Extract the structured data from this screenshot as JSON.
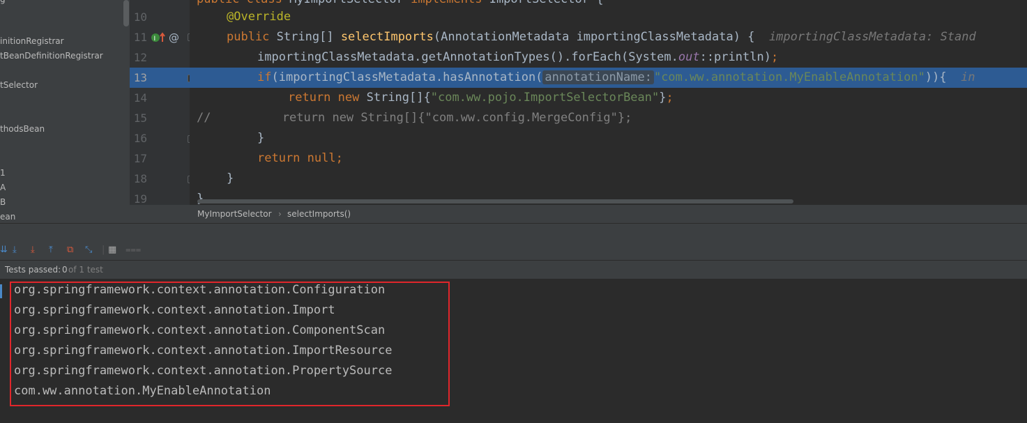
{
  "sidebar": {
    "items": [
      "g",
      "initionRegistrar",
      "tBeanDefinitionRegistrar",
      "tSelector",
      "thodsBean",
      "1",
      "A",
      "B",
      "ean"
    ]
  },
  "editor": {
    "lines": [
      {
        "num": "10"
      },
      {
        "num": "11"
      },
      {
        "num": "12"
      },
      {
        "num": "13"
      },
      {
        "num": "14"
      },
      {
        "num": "15"
      },
      {
        "num": "16"
      },
      {
        "num": "17"
      },
      {
        "num": "18"
      },
      {
        "num": "19"
      }
    ],
    "hint_param": "importingClassMetadata: Stand",
    "inline_hint": "annotationName:",
    "trailing_hint": "in"
  },
  "breadcrumb": {
    "class_name": "MyImportSelector",
    "method_name": "selectImports()",
    "separator": "›"
  },
  "status": {
    "prefix": "Tests passed: ",
    "passed": "0",
    "suffix": " of 1 test"
  },
  "console": {
    "lines": [
      "org.springframework.context.annotation.Configuration",
      "org.springframework.context.annotation.Import",
      "org.springframework.context.annotation.ComponentScan",
      "org.springframework.context.annotation.ImportResource",
      "org.springframework.context.annotation.PropertySource",
      "com.ww.annotation.MyEnableAnnotation"
    ]
  },
  "colors": {
    "selection": "#2d5b93",
    "highlight_box": "#e0262b",
    "keyword": "#cc7832",
    "string": "#6a8759"
  }
}
